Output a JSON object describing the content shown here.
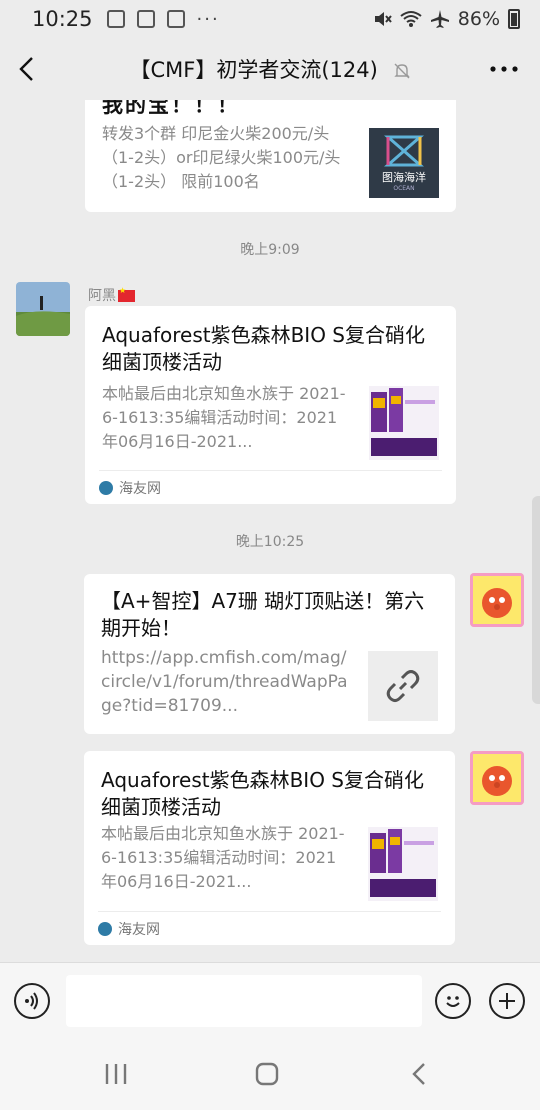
{
  "status": {
    "time": "10:25",
    "more_dots": "···",
    "battery_text": "86%"
  },
  "header": {
    "title": "【CMF】初学者交流(124)"
  },
  "messages": [
    {
      "title_fragment": "我的宝！！！",
      "description": "转发3个群 印尼金火柴200元/头（1-2头）or印尼绿火柴100元/头（1-2头） 限前100名",
      "thumbnail_label": "图海海洋",
      "thumbnail_sublabel": "OCEAN"
    },
    {
      "timestamp": "晚上9:09"
    },
    {
      "sender": "阿黑",
      "title": "Aquaforest紫色森林BIO S复合硝化细菌顶楼活动",
      "description": "本帖最后由北京知鱼水族于 2021-6-1613:35编辑活动时间：2021年06月16日-2021...",
      "source": "海友网"
    },
    {
      "timestamp": "晚上10:25"
    },
    {
      "title": "【A+智控】A7珊 瑚灯顶贴送！第六期开始！",
      "description": "https://app.cmfish.com/mag/circle/v1/forum/threadWapPage?tid=81709...",
      "icon": "link-icon"
    },
    {
      "title": "Aquaforest紫色森林BIO S复合硝化细菌顶楼活动",
      "description": "本帖最后由北京知鱼水族于 2021-6-1613:35编辑活动时间：2021年06月16日-2021...",
      "source": "海友网"
    }
  ],
  "input": {
    "placeholder": ""
  },
  "colors": {
    "background": "#ececec",
    "card": "#ffffff",
    "secondary_text": "#8a8a8a"
  }
}
